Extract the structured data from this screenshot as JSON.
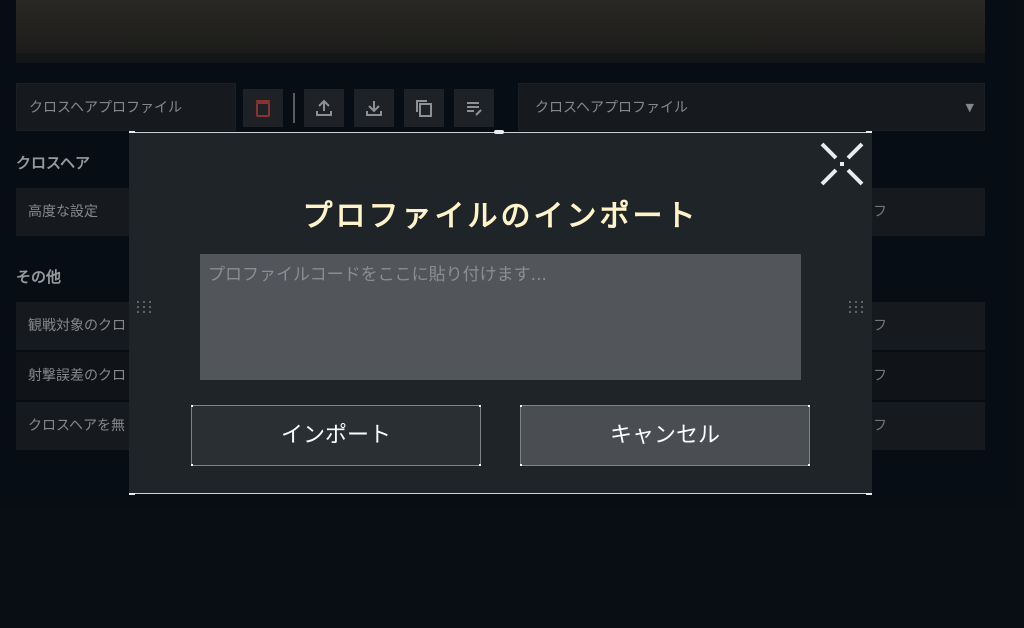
{
  "toolbar": {
    "profile_label": "クロスヘアプロファイル",
    "profile_select_value": "クロスヘアプロファイル",
    "icons": [
      "trash-icon",
      "upload-icon",
      "download-icon",
      "copy-icon",
      "edit-list-icon"
    ]
  },
  "sections": {
    "crosshair": {
      "title": "クロスヘア",
      "rows": [
        {
          "label": "高度な設定",
          "value": "フ"
        }
      ]
    },
    "other": {
      "title": "その他",
      "rows": [
        {
          "label": "観戦対象のクロ",
          "value": "フ"
        },
        {
          "label": "射撃誤差のクロ",
          "value": "フ"
        },
        {
          "label": "クロスヘアを無",
          "value": "フ"
        }
      ]
    }
  },
  "modal": {
    "title": "プロファイルのインポート",
    "input_placeholder": "プロファイルコードをここに貼り付けます...",
    "input_value": "",
    "import_label": "インポート",
    "cancel_label": "キャンセル"
  },
  "colors": {
    "title_text": "#fff3c9",
    "delete_icon": "#c0463f",
    "accent_white": "#ffffff"
  }
}
